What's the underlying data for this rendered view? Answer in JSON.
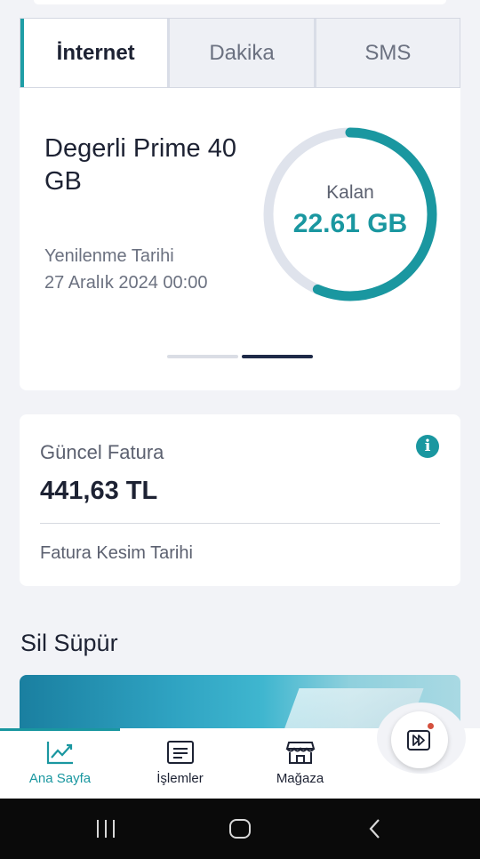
{
  "tabs": [
    {
      "label": "İnternet",
      "active": true
    },
    {
      "label": "Dakika",
      "active": false
    },
    {
      "label": "SMS",
      "active": false
    }
  ],
  "usage": {
    "package_name": "Degerli Prime 40 GB",
    "renewal_label": "Yenilenme Tarihi",
    "renewal_date": "27 Aralık 2024 00:00",
    "remaining_label": "Kalan",
    "remaining_value": "22.61 GB",
    "remaining_fraction": 0.565,
    "carousel_pages": 2,
    "carousel_active": 1
  },
  "bill": {
    "title": "Güncel Fatura",
    "amount": "441,63 TL",
    "cut_date_label": "Fatura Kesim Tarihi",
    "info_icon": "info-icon"
  },
  "section": {
    "title": "Sil Süpür"
  },
  "nav": {
    "items": [
      {
        "label": "Ana Sayfa",
        "icon": "chart-line-icon",
        "active": true
      },
      {
        "label": "İşlemler",
        "icon": "receipt-icon",
        "active": false
      },
      {
        "label": "Mağaza",
        "icon": "store-icon",
        "active": false
      }
    ],
    "fab_icon": "fast-forward-icon"
  },
  "colors": {
    "accent": "#1a97a0",
    "ring_track": "#dfe3ec",
    "carousel_active": "#1e2a48",
    "notification": "#d4503e"
  }
}
